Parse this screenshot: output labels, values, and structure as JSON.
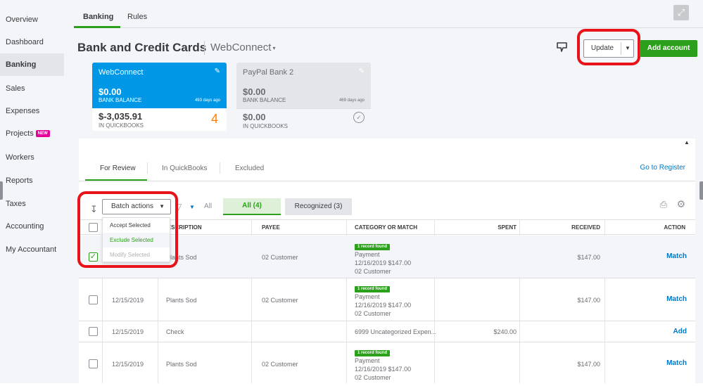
{
  "leftnav": {
    "items": [
      {
        "label": "Overview"
      },
      {
        "label": "Dashboard"
      },
      {
        "label": "Banking"
      },
      {
        "label": "Sales"
      },
      {
        "label": "Expenses"
      },
      {
        "label": "Projects",
        "badge": "NEW"
      },
      {
        "label": "Workers"
      },
      {
        "label": "Reports"
      },
      {
        "label": "Taxes"
      },
      {
        "label": "Accounting"
      },
      {
        "label": "My Accountant"
      }
    ],
    "active": "Banking"
  },
  "top_tabs": [
    {
      "label": "Banking"
    },
    {
      "label": "Rules"
    }
  ],
  "header": {
    "title": "Bank and Credit Cards",
    "account_select": "WebConnect",
    "update_label": "Update",
    "add_account_label": "Add account"
  },
  "cards": [
    {
      "name": "WebConnect",
      "bank_amount": "$0.00",
      "bank_label": "BANK BALANCE",
      "days_ago": "493 days ago",
      "qb_amount": "$-3,035.91",
      "qb_label": "IN QUICKBOOKS",
      "pending": "4",
      "selected": true
    },
    {
      "name": "PayPal Bank 2",
      "bank_amount": "$0.00",
      "bank_label": "BANK BALANCE",
      "days_ago": "469 days ago",
      "qb_amount": "$0.00",
      "qb_label": "IN QUICKBOOKS",
      "selected": false
    }
  ],
  "sub_tabs": [
    {
      "label": "For Review"
    },
    {
      "label": "In QuickBooks"
    },
    {
      "label": "Excluded"
    }
  ],
  "go_to_register": "Go to Register",
  "toolbar": {
    "batch_label": "Batch actions",
    "filter_value": "All",
    "seg_all": "All (4)",
    "seg_recognized": "Recognized (3)"
  },
  "batch_menu": [
    "Accept Selected",
    "Exclude Selected",
    "Modify Selected"
  ],
  "columns": {
    "description": "DESCRIPTION",
    "payee": "PAYEE",
    "category": "CATEGORY OR MATCH",
    "spent": "SPENT",
    "received": "RECEIVED",
    "action": "ACTION"
  },
  "rows": [
    {
      "date": "",
      "description": "Plants Sod",
      "payee": "02 Customer",
      "badge": "1 record found",
      "match": [
        "Payment",
        "12/16/2019 $147.00",
        "02 Customer"
      ],
      "spent": "",
      "received": "$147.00",
      "action": "Match",
      "checked": true
    },
    {
      "date": "12/15/2019",
      "description": "Plants Sod",
      "payee": "02 Customer",
      "badge": "1 record found",
      "match": [
        "Payment",
        "12/16/2019 $147.00",
        "02 Customer"
      ],
      "spent": "",
      "received": "$147.00",
      "action": "Match",
      "checked": false
    },
    {
      "date": "12/15/2019",
      "description": "Check",
      "payee": "",
      "category": "6999 Uncategorized Expen...",
      "spent": "$240.00",
      "received": "",
      "action": "Add",
      "checked": false
    },
    {
      "date": "12/15/2019",
      "description": "Plants Sod",
      "payee": "02 Customer",
      "badge": "1 record found",
      "match": [
        "Payment",
        "12/16/2019 $147.00",
        "02 Customer"
      ],
      "spent": "",
      "received": "$147.00",
      "action": "Match",
      "checked": false
    }
  ],
  "colors": {
    "accent_green": "#2ca01c",
    "link_blue": "#0077c5",
    "card_blue": "#0097e6",
    "highlight_red": "#e8131a",
    "pending_orange": "#ff8000"
  }
}
